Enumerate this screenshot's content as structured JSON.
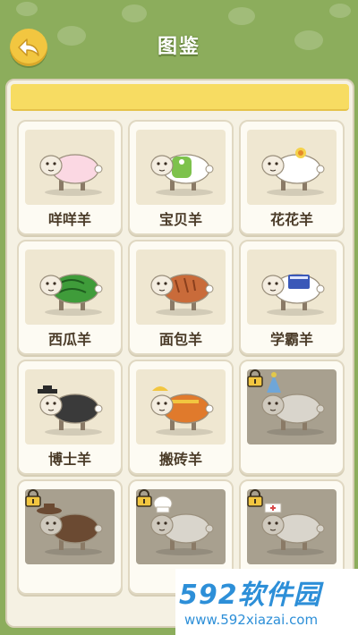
{
  "header": {
    "title": "图鉴",
    "back_icon": "back-arrow-icon"
  },
  "cards": [
    {
      "name": "咩咩羊",
      "locked": false,
      "icon": "plain-sheep"
    },
    {
      "name": "宝贝羊",
      "locked": false,
      "icon": "baby-sheep"
    },
    {
      "name": "花花羊",
      "locked": false,
      "icon": "flower-sheep"
    },
    {
      "name": "西瓜羊",
      "locked": false,
      "icon": "watermelon-sheep"
    },
    {
      "name": "面包羊",
      "locked": false,
      "icon": "bread-sheep"
    },
    {
      "name": "学霸羊",
      "locked": false,
      "icon": "scholar-sheep"
    },
    {
      "name": "博士羊",
      "locked": false,
      "icon": "doctor-sheep"
    },
    {
      "name": "搬砖羊",
      "locked": false,
      "icon": "worker-sheep"
    },
    {
      "name": "",
      "locked": true,
      "icon": "party-sheep"
    },
    {
      "name": "",
      "locked": true,
      "icon": "cowboy-sheep"
    },
    {
      "name": "",
      "locked": true,
      "icon": "chef-sheep"
    },
    {
      "name": "",
      "locked": true,
      "icon": "nurse-sheep"
    }
  ],
  "watermark": {
    "line1": "592软件园",
    "line2": "www.592xiazai.com"
  },
  "colors": {
    "header_green": "#8cad5c",
    "panel_bg": "#f5f1e3",
    "yellow_bar": "#f7dc62",
    "locked_thumb": "#a8a08f",
    "back_button": "#f2c640"
  }
}
